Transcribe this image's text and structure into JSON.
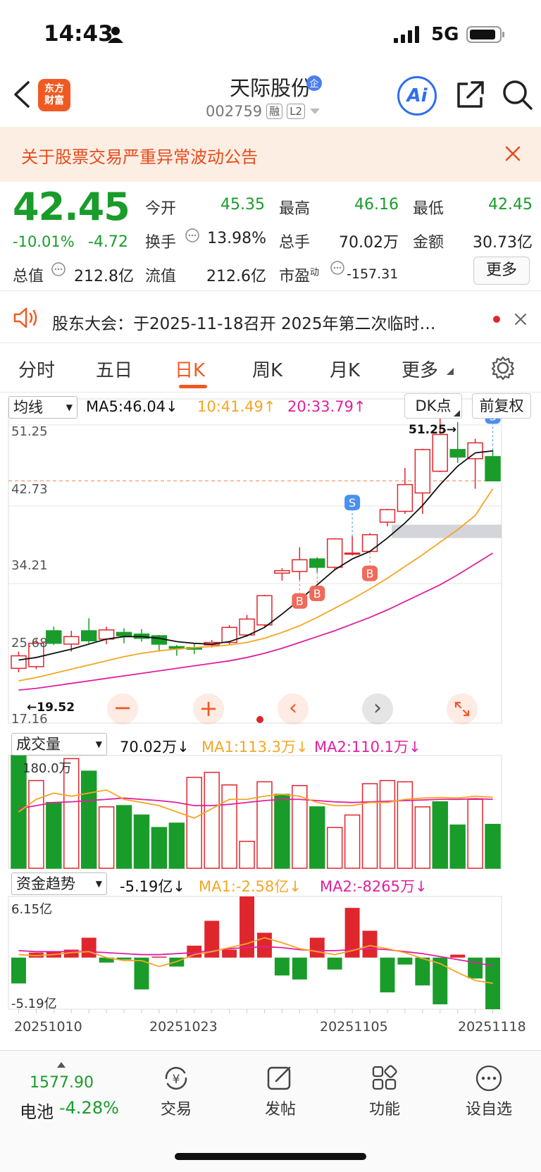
{
  "status_bar": {
    "time": "14:43",
    "network": "5G"
  },
  "header": {
    "app_logo_text": "东方财富",
    "stock_name": "天际股份",
    "stock_code": "002759",
    "tag_margin": "融",
    "tag_level": "L2",
    "ai_label": "Ai"
  },
  "notice": {
    "text": "关于股票交易严重异常波动公告"
  },
  "quote": {
    "price": "42.45",
    "change_pct": "-10.01%",
    "change": "-4.72",
    "open_label": "今开",
    "open": "45.35",
    "high_label": "最高",
    "high": "46.16",
    "low_label": "最低",
    "low": "42.45",
    "turnover_label": "换手",
    "turnover": "13.98%",
    "volume_label": "总手",
    "volume": "70.02万",
    "amount_label": "金额",
    "amount": "30.73亿",
    "mktcap_label": "总值",
    "mktcap": "212.8亿",
    "float_label": "流值",
    "float_cap": "212.6亿",
    "pe_label": "市盈",
    "pe_sup": "动",
    "pe": "-157.31",
    "more_label": "更多"
  },
  "shareholder_notice": {
    "text": "股东大会：于2025-11-18召开 2025年第二次临时…"
  },
  "tabs": [
    {
      "label": "分时",
      "active": false
    },
    {
      "label": "五日",
      "active": false
    },
    {
      "label": "日K",
      "active": true
    },
    {
      "label": "周K",
      "active": false
    },
    {
      "label": "月K",
      "active": false
    },
    {
      "label": "更多",
      "active": false
    }
  ],
  "kline_controls": {
    "indicator": "均线",
    "ma5": "MA5:46.04↓",
    "ma10": "10:41.49↑",
    "ma20": "20:33.79↑",
    "dk_button": "DK点",
    "adjust_button": "前复权",
    "y_labels": [
      "51.25",
      "42.73",
      "34.21",
      "25.68",
      "17.16"
    ],
    "high_marker": "51.25→",
    "low_marker": "←19.52"
  },
  "volume_controls": {
    "indicator": "成交量",
    "value": "70.02万↓",
    "ma1": "MA1:113.3万↓",
    "ma2": "MA2:110.1万↓",
    "y_label": "180.0万"
  },
  "fund_controls": {
    "indicator": "资金趋势",
    "value": "-5.19亿↓",
    "ma1": "MA1:-2.58亿↓",
    "ma2": "MA2:-8265万↓",
    "y_top": "6.15亿",
    "y_bottom": "-5.19亿"
  },
  "x_dates": [
    "20251010",
    "20251023",
    "20251105",
    "20251118"
  ],
  "colors": {
    "up": "#e0262d",
    "down": "#1a9c2a",
    "ma5": "#111111",
    "ma10": "#f5a623",
    "ma20": "#e020a0",
    "accent": "#f05a22"
  },
  "chart_data": [
    {
      "type": "candlestick",
      "title": "",
      "ylim": [
        17.16,
        51.25
      ],
      "candles": [
        {
          "o": 20.0,
          "c": 21.5,
          "h": 22.0,
          "l": 19.52
        },
        {
          "o": 20.2,
          "c": 23.0,
          "h": 23.5,
          "l": 19.9
        },
        {
          "o": 24.5,
          "c": 23.0,
          "h": 25.0,
          "l": 22.8
        },
        {
          "o": 22.9,
          "c": 23.8,
          "h": 24.5,
          "l": 22.0
        },
        {
          "o": 24.5,
          "c": 23.3,
          "h": 26.0,
          "l": 23.0
        },
        {
          "o": 23.5,
          "c": 24.6,
          "h": 25.0,
          "l": 22.9
        },
        {
          "o": 24.3,
          "c": 23.9,
          "h": 24.8,
          "l": 23.0
        },
        {
          "o": 24.1,
          "c": 23.6,
          "h": 24.7,
          "l": 23.2
        },
        {
          "o": 23.9,
          "c": 22.9,
          "h": 24.0,
          "l": 22.0
        },
        {
          "o": 22.6,
          "c": 22.4,
          "h": 22.8,
          "l": 21.5
        },
        {
          "o": 22.5,
          "c": 22.3,
          "h": 22.9,
          "l": 21.7
        },
        {
          "o": 22.8,
          "c": 23.1,
          "h": 23.4,
          "l": 22.5
        },
        {
          "o": 23.1,
          "c": 24.9,
          "h": 25.2,
          "l": 22.8
        },
        {
          "o": 24.0,
          "c": 25.9,
          "h": 26.4,
          "l": 23.8
        },
        {
          "o": 25.2,
          "c": 28.7,
          "h": 28.8,
          "l": 25.0
        },
        {
          "o": 31.4,
          "c": 31.7,
          "h": 32.0,
          "l": 30.5
        },
        {
          "o": 31.6,
          "c": 33.0,
          "h": 34.5,
          "l": 30.6
        },
        {
          "o": 33.1,
          "c": 32.1,
          "h": 33.3,
          "l": 31.5
        },
        {
          "o": 32.1,
          "c": 35.5,
          "h": 35.6,
          "l": 31.8
        },
        {
          "o": 33.8,
          "c": 33.8,
          "h": 35.8,
          "l": 33.5
        },
        {
          "o": 34.0,
          "c": 36.0,
          "h": 36.2,
          "l": 33.9
        },
        {
          "o": 37.5,
          "c": 39.0,
          "h": 39.1,
          "l": 37.0
        },
        {
          "o": 38.8,
          "c": 42.0,
          "h": 44.0,
          "l": 38.5
        },
        {
          "o": 41.0,
          "c": 46.2,
          "h": 46.3,
          "l": 38.5
        },
        {
          "o": 43.6,
          "c": 48.0,
          "h": 51.25,
          "l": 43.5
        },
        {
          "o": 46.2,
          "c": 45.3,
          "h": 49.5,
          "l": 44.6
        },
        {
          "o": 45.1,
          "c": 47.0,
          "h": 47.5,
          "l": 41.5
        },
        {
          "o": 45.35,
          "c": 42.45,
          "h": 46.16,
          "l": 42.45
        }
      ],
      "ma5": [
        21.0,
        21.3,
        21.8,
        22.3,
        22.9,
        23.5,
        23.8,
        23.8,
        23.6,
        23.2,
        23.0,
        22.9,
        23.2,
        23.9,
        24.9,
        26.5,
        28.2,
        30.0,
        31.8,
        33.1,
        34.0,
        35.6,
        37.4,
        39.5,
        42.0,
        44.2,
        45.8,
        46.04
      ],
      "ma10": [
        18.5,
        18.9,
        19.4,
        19.9,
        20.4,
        20.9,
        21.4,
        21.8,
        22.1,
        22.3,
        22.5,
        22.6,
        22.8,
        23.1,
        23.6,
        24.3,
        25.1,
        26.1,
        27.2,
        28.3,
        29.5,
        30.8,
        32.2,
        33.6,
        35.1,
        36.6,
        38.3,
        41.49
      ],
      "ma20": [
        17.4,
        17.6,
        17.9,
        18.2,
        18.5,
        18.8,
        19.1,
        19.4,
        19.7,
        20.0,
        20.3,
        20.6,
        20.9,
        21.3,
        21.8,
        22.4,
        23.1,
        23.8,
        24.5,
        25.3,
        26.1,
        27.0,
        28.0,
        29.0,
        30.0,
        31.2,
        32.5,
        33.79
      ],
      "signals": [
        {
          "index": 16,
          "kind": "B"
        },
        {
          "index": 17,
          "kind": "B"
        },
        {
          "index": 19,
          "kind": "S"
        },
        {
          "index": 20,
          "kind": "B"
        },
        {
          "index": 27,
          "kind": "S"
        }
      ]
    },
    {
      "type": "bar",
      "title": "成交量",
      "ylim": [
        0,
        180
      ],
      "values": [
        180,
        140,
        105,
        175,
        155,
        98,
        100,
        85,
        65,
        72,
        145,
        153,
        133,
        43,
        138,
        118,
        132,
        98,
        65,
        85,
        135,
        140,
        138,
        98,
        106,
        69,
        110,
        70.02
      ],
      "up": [
        false,
        true,
        false,
        true,
        false,
        true,
        false,
        false,
        false,
        false,
        true,
        true,
        true,
        true,
        true,
        false,
        true,
        false,
        true,
        true,
        true,
        true,
        true,
        true,
        false,
        false,
        true,
        false
      ],
      "ma1": [
        90,
        110,
        120,
        115,
        120,
        125,
        110,
        105,
        100,
        90,
        80,
        95,
        110,
        110,
        115,
        118,
        115,
        105,
        100,
        100,
        105,
        105,
        110,
        112,
        113,
        112,
        115,
        113.3
      ],
      "ma2": [
        95,
        100,
        105,
        106,
        108,
        110,
        112,
        110,
        108,
        105,
        100,
        100,
        102,
        105,
        108,
        110,
        110,
        108,
        106,
        105,
        106,
        107,
        108,
        109,
        110,
        110,
        111,
        110.1
      ]
    },
    {
      "type": "bar",
      "title": "资金趋势",
      "ylim": [
        -5.19,
        6.15
      ],
      "values": [
        -2.6,
        0.5,
        0.6,
        0.8,
        2.0,
        -0.5,
        -0.2,
        -3.2,
        0.1,
        -0.9,
        1.2,
        3.7,
        0.8,
        6.15,
        2.5,
        -1.8,
        -2.2,
        2.0,
        -1.2,
        5.0,
        2.7,
        -3.5,
        -0.7,
        -2.8,
        -4.7,
        0.3,
        -2.1,
        -5.19
      ],
      "ma1": [
        0.3,
        0.2,
        0.3,
        0.5,
        0.6,
        0.0,
        -0.3,
        -0.3,
        -0.9,
        -0.4,
        0.3,
        0.6,
        1.0,
        1.4,
        2.0,
        1.5,
        0.9,
        0.6,
        0.3,
        0.7,
        1.2,
        0.9,
        0.5,
        -0.1,
        -0.6,
        -1.5,
        -2.3,
        -2.58
      ],
      "ma2": [
        0.7,
        0.6,
        0.6,
        0.6,
        0.6,
        0.5,
        0.4,
        0.3,
        0.3,
        0.4,
        0.5,
        0.7,
        0.9,
        1.0,
        1.1,
        1.0,
        0.8,
        0.7,
        0.7,
        0.8,
        0.9,
        0.8,
        0.6,
        0.4,
        0.1,
        -0.2,
        -0.5,
        -0.83
      ]
    }
  ],
  "bottom_nav": {
    "index_value": "1577.90",
    "index_label": "电池",
    "index_change": "-4.28%",
    "items": [
      "交易",
      "发帖",
      "功能",
      "设自选"
    ]
  }
}
